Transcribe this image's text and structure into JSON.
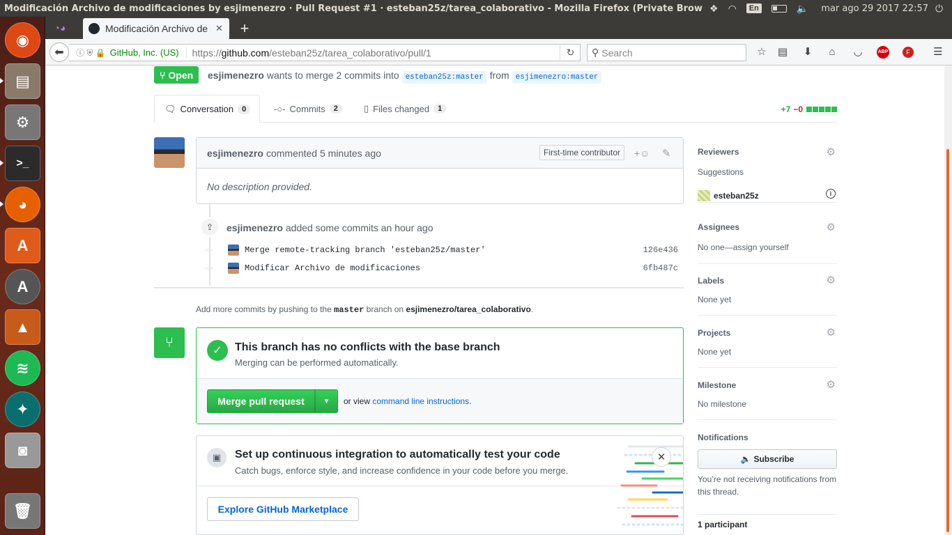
{
  "system": {
    "window_title": "Modificación Archivo de modificaciones by esjimenezro · Pull Request #1 · esteban25z/tarea_colaborativo - Mozilla Firefox (Private Browsing)",
    "language": "En",
    "clock": "mar ago 29 2017 22:57"
  },
  "browser": {
    "tab_title": "Modificación Archivo de modificaciones",
    "identity": "GitHub, Inc. (US)",
    "url_scheme": "https://",
    "url_host": "github.com",
    "url_path": "/esteban25z/tarea_colaborativo/pull/1",
    "search_placeholder": "Search",
    "adblock_label": "ABP"
  },
  "pr": {
    "state": "Open",
    "author": "esjimenezro",
    "merge_text": "wants to merge 2 commits into",
    "base_ref": "esteban25z:master",
    "from_text": "from",
    "head_ref": "esjimenezro:master",
    "tabs": [
      {
        "label": "Conversation",
        "count": "0"
      },
      {
        "label": "Commits",
        "count": "2"
      },
      {
        "label": "Files changed",
        "count": "1"
      }
    ],
    "additions": "+7",
    "deletions": "−0"
  },
  "comment": {
    "author": "esjimenezro",
    "action": "commented 5 minutes ago",
    "badge": "First-time contributor",
    "body": "No description provided."
  },
  "commits_event": {
    "author": "esjimenezro",
    "text": "added some commits an hour ago",
    "commits": [
      {
        "message": "Merge remote-tracking branch 'esteban25z/master'",
        "sha": "126e436"
      },
      {
        "message": "Modificar Archivo de modificaciones",
        "sha": "6fb487c"
      }
    ]
  },
  "push_hint": {
    "prefix": "Add more commits by pushing to the",
    "branch": "master",
    "middle": "branch on",
    "repo": "esjimenezro/tarea_colaborativo",
    "suffix": "."
  },
  "merge": {
    "heading": "This branch has no conflicts with the base branch",
    "subtext": "Merging can be performed automatically.",
    "button": "Merge pull request",
    "alt_prefix": "or view",
    "alt_link": "command line instructions",
    "alt_suffix": "."
  },
  "ci": {
    "heading": "Set up continuous integration to automatically test your code",
    "subtext": "Catch bugs, enforce style, and increase confidence in your code before you merge.",
    "button": "Explore GitHub Marketplace"
  },
  "sidebar": {
    "reviewers": {
      "heading": "Reviewers",
      "suggestions": "Suggestions",
      "suggested_user": "esteban25z"
    },
    "assignees": {
      "heading": "Assignees",
      "value": "No one—assign yourself"
    },
    "labels": {
      "heading": "Labels",
      "value": "None yet"
    },
    "projects": {
      "heading": "Projects",
      "value": "None yet"
    },
    "milestone": {
      "heading": "Milestone",
      "value": "No milestone"
    },
    "notifications": {
      "heading": "Notifications",
      "button": "Subscribe",
      "text": "You’re not receiving notifications from this thread."
    },
    "participants": "1 participant"
  },
  "colors": {
    "accent_green": "#2cbe4e",
    "link_blue": "#0366d6",
    "launcher_bg": "#5a2416"
  }
}
